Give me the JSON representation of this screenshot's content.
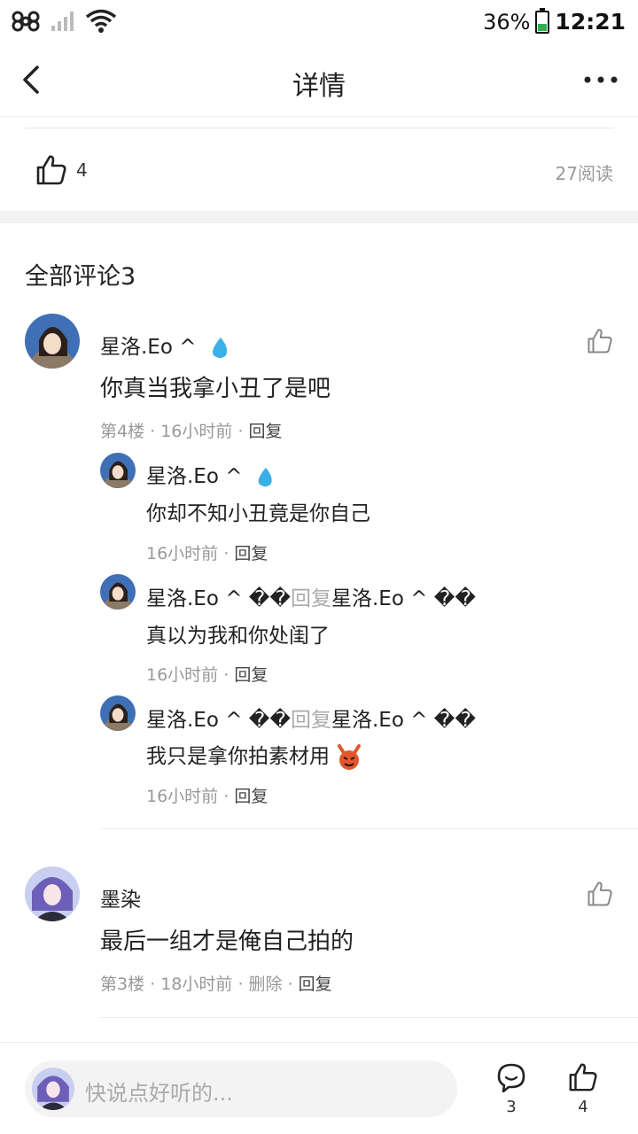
{
  "status": {
    "battery": "36%",
    "time": "12:21"
  },
  "nav": {
    "title": "详情"
  },
  "post": {
    "likes": "4",
    "reads": "27阅读"
  },
  "comments_title": "全部评论3",
  "comments": [
    {
      "user": "星洛.Eo ^",
      "text": "你真当我拿小丑了是吧",
      "floor": "第4楼",
      "time": "16小时前",
      "reply": "回复",
      "replies": [
        {
          "user": "星洛.Eo ^",
          "text": "你却不知小丑竟是你自己",
          "time": "16小时前",
          "reply": "回复"
        },
        {
          "user": "星洛.Eo ^ ��",
          "reply_word": "回复",
          "target": "星洛.Eo ^ ��",
          "text": "真以为我和你处闺了",
          "time": "16小时前",
          "reply": "回复"
        },
        {
          "user": "星洛.Eo ^ ��",
          "reply_word": "回复",
          "target": "星洛.Eo ^ ��",
          "text": "我只是拿你拍素材用",
          "time": "16小时前",
          "reply": "回复"
        }
      ]
    },
    {
      "user": "墨染",
      "text": "最后一组才是俺自己拍的",
      "floor": "第3楼",
      "time": "18小时前",
      "delete": "删除",
      "reply": "回复"
    }
  ],
  "bottom": {
    "placeholder": "快说点好听的...",
    "comment_count": "3",
    "like_count": "4"
  },
  "icons": [
    "back-icon",
    "more-icon",
    "thumb-up-icon",
    "sweat-drop-icon",
    "devil-emoji-icon",
    "comment-bubble-icon"
  ],
  "colors": {
    "accent_drop": "#3ab0e6",
    "gray_text": "#999999",
    "devil": "#e2572b"
  }
}
